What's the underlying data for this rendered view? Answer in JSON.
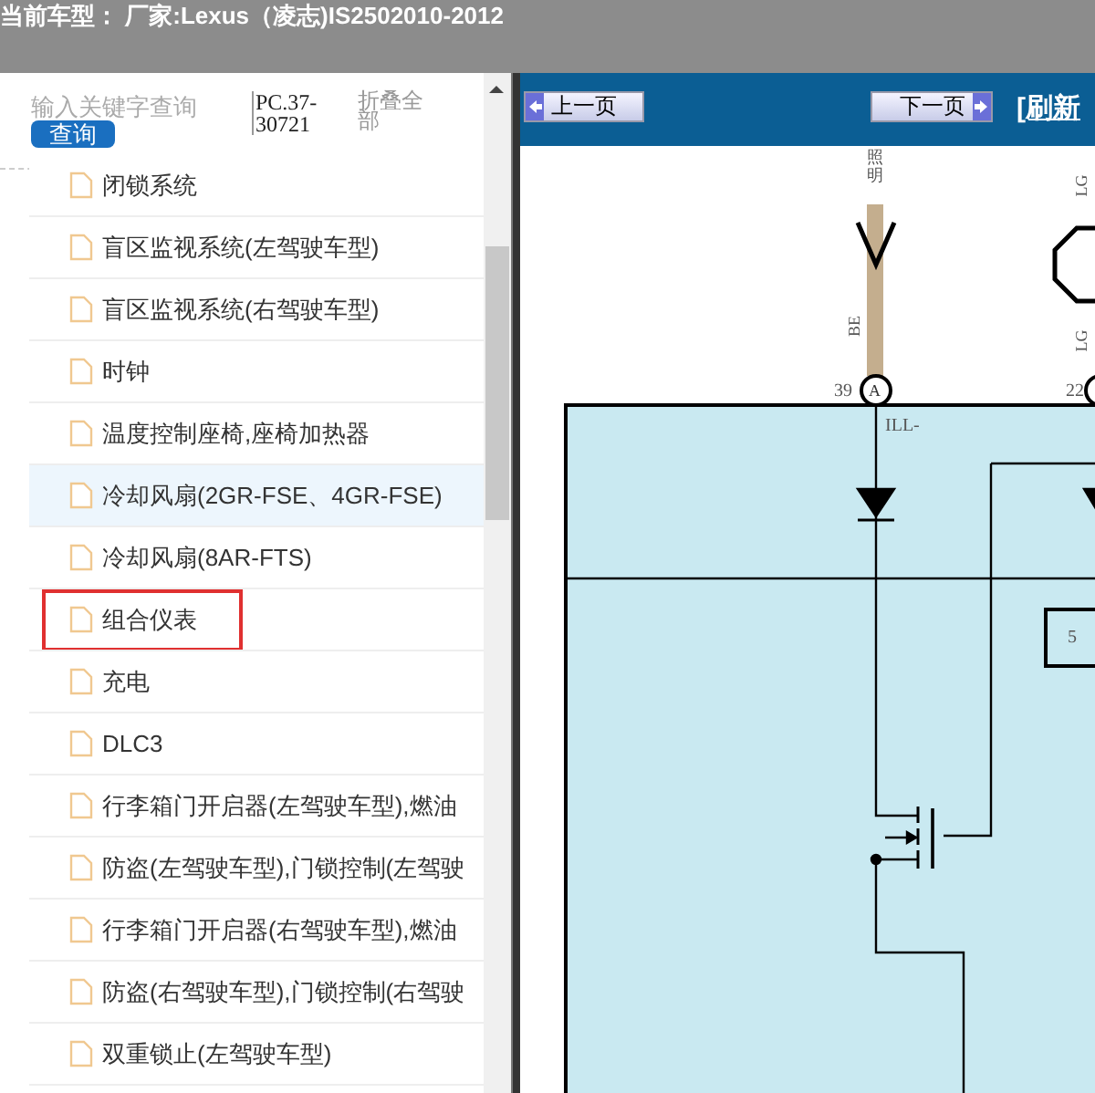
{
  "header": {
    "title": "当前车型： 厂家:Lexus（凌志)IS2502010-2012"
  },
  "sidebar": {
    "search": {
      "placeholder": "输入关键字查询"
    },
    "search_button": "查询",
    "code": "PC.37-30721",
    "collapse_all": "折叠全部",
    "items": [
      {
        "label": "闭锁系统",
        "selected": false,
        "highlighted": false
      },
      {
        "label": "盲区监视系统(左驾驶车型)",
        "selected": false,
        "highlighted": false
      },
      {
        "label": "盲区监视系统(右驾驶车型)",
        "selected": false,
        "highlighted": false
      },
      {
        "label": "时钟",
        "selected": false,
        "highlighted": false
      },
      {
        "label": "温度控制座椅,座椅加热器",
        "selected": false,
        "highlighted": false
      },
      {
        "label": "冷却风扇(2GR-FSE、4GR-FSE)",
        "selected": true,
        "highlighted": false
      },
      {
        "label": "冷却风扇(8AR-FTS)",
        "selected": false,
        "highlighted": false
      },
      {
        "label": "组合仪表",
        "selected": false,
        "highlighted": true
      },
      {
        "label": "充电",
        "selected": false,
        "highlighted": false
      },
      {
        "label": "DLC3",
        "selected": false,
        "highlighted": false
      },
      {
        "label": "行李箱门开启器(左驾驶车型),燃油",
        "selected": false,
        "highlighted": false
      },
      {
        "label": "防盗(左驾驶车型),门锁控制(左驾驶",
        "selected": false,
        "highlighted": false
      },
      {
        "label": "行李箱门开启器(右驾驶车型),燃油",
        "selected": false,
        "highlighted": false
      },
      {
        "label": "防盗(右驾驶车型),门锁控制(右驾驶",
        "selected": false,
        "highlighted": false
      },
      {
        "label": "双重锁止(左驾驶车型)",
        "selected": false,
        "highlighted": false
      }
    ]
  },
  "toolbar": {
    "prev_button": "上一页",
    "next_button": "下一页",
    "refresh_link": "[刷新"
  },
  "diagram": {
    "wire_label": "照明",
    "wire_color_1": "BE",
    "wire_color_2": "LG",
    "wire_color_3": "LG",
    "pin_1": "39",
    "connector_1": "A",
    "pin_2": "22",
    "signal": "ILL-",
    "box_label": "5"
  }
}
